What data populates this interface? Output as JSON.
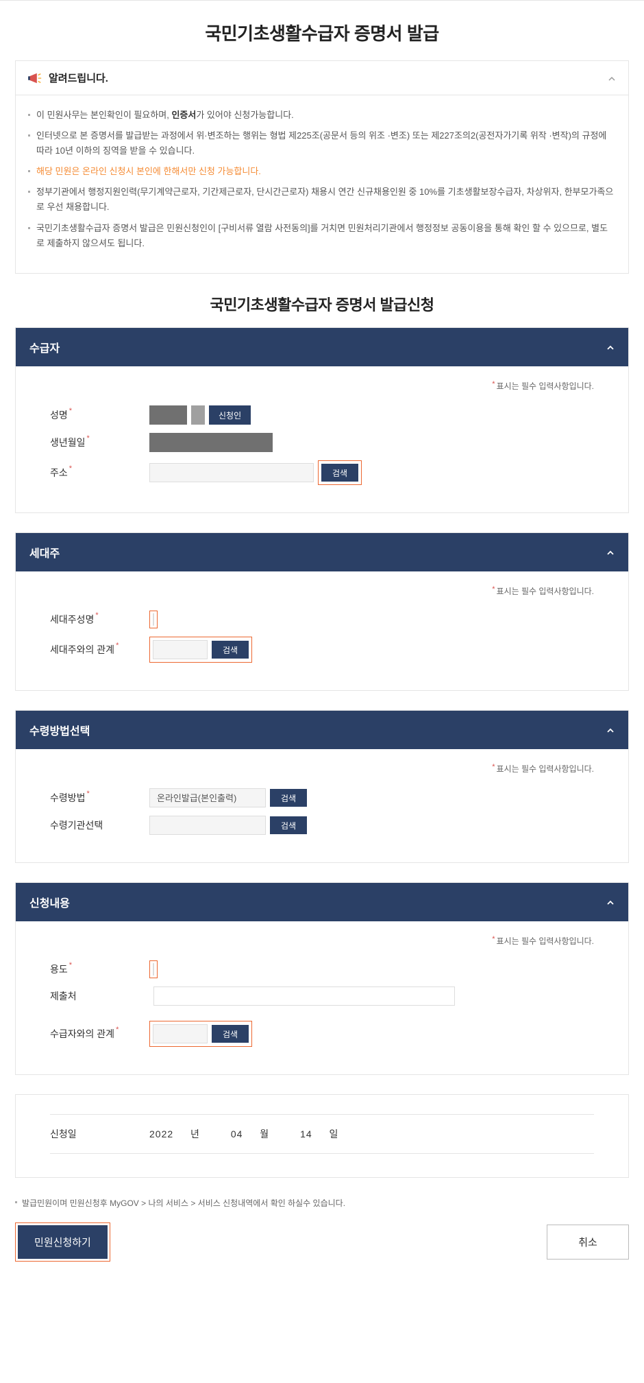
{
  "page": {
    "title": "국민기초생활수급자 증명서 발급",
    "sub_title": "국민기초생활수급자 증명서 발급신청"
  },
  "notice": {
    "header": "알려드립니다.",
    "items": [
      {
        "prefix": "이 민원사무는 본인확인이 필요하며, ",
        "bold": "인증서",
        "suffix": "가 있어야 신청가능합니다."
      },
      {
        "text": "인터넷으로 본 증명서를 발급받는 과정에서 위·변조하는 행위는 형법 제225조(공문서 등의 위조 ·변조) 또는 제227조의2(공전자가기록 위작 ·변작)의 규정에 따라 10년 이하의 징역을 받을 수 있습니다."
      },
      {
        "text": "해당 민원은 온라인 신청시 본인에 한해서만 신청 가능합니다.",
        "hl": true
      },
      {
        "text": "정부기관에서 행정지원인력(무기계약근로자, 기간제근로자, 단시간근로자) 채용시 연간 신규채용인원 중 10%를 기초생활보장수급자, 차상위자, 한부모가족으로 우선 채용합니다."
      },
      {
        "text": "국민기초생활수급자 증명서 발급은 민원신청인이 [구비서류 열람 사전동의]를 거치면 민원처리기관에서 행정정보 공동이용을 통해 확인 할 수 있으므로, 별도로 제출하지 않으셔도 됩니다."
      }
    ]
  },
  "required_note": "표시는 필수 입력사항입니다.",
  "sections": {
    "recipient": {
      "title": "수급자",
      "fields": {
        "name": "성명",
        "birth": "생년월일",
        "address": "주소"
      },
      "applicant_btn": "신청인",
      "search_btn": "검색"
    },
    "household": {
      "title": "세대주",
      "fields": {
        "head_name": "세대주성명",
        "relation": "세대주와의 관계"
      },
      "search_btn": "검색"
    },
    "receive": {
      "title": "수령방법선택",
      "fields": {
        "method": "수령방법",
        "org": "수령기관선택"
      },
      "method_value": "온라인발급(본인출력)",
      "search_btn": "검색"
    },
    "apply": {
      "title": "신청내용",
      "fields": {
        "purpose": "용도",
        "submit_to": "제출처",
        "relation": "수급자와의 관계"
      },
      "search_btn": "검색"
    }
  },
  "date": {
    "label": "신청일",
    "year": "2022",
    "year_unit": "년",
    "month": "04",
    "month_unit": "월",
    "day": "14",
    "day_unit": "일"
  },
  "footer": {
    "note": "발급민원이며 민원신청후 MyGOV > 나의 서비스 > 서비스 신청내역에서 확인 하실수 있습니다.",
    "submit": "민원신청하기",
    "cancel": "취소"
  }
}
